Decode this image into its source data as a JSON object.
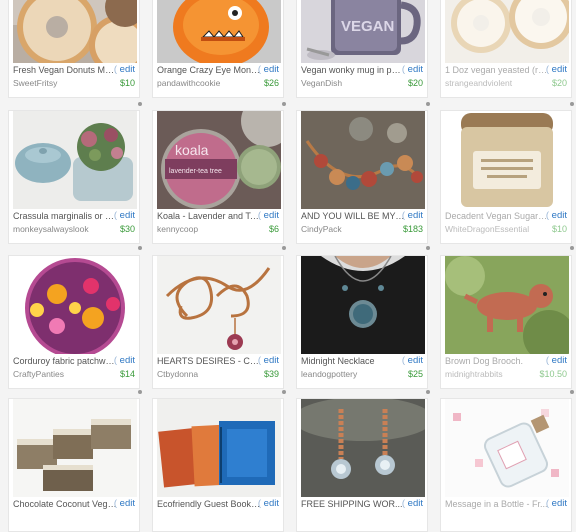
{
  "edit_label": "edit",
  "items": [
    {
      "title": "Fresh Vegan Donuts Ma...",
      "shop": "SweetFritsy",
      "price": "$10",
      "image": "donuts"
    },
    {
      "title": "Orange Crazy Eye Monst...",
      "shop": "pandawithcookie",
      "price": "$26",
      "image": "orange-monster"
    },
    {
      "title": "Vegan wonky mug in pur...",
      "shop": "VeganDish",
      "price": "$20",
      "image": "vegan-mug",
      "mug_text": "VEGAN"
    },
    {
      "title": "1 Doz vegan yeasted (rai...",
      "shop": "strangeandviolent",
      "price": "$20",
      "image": "yeasted-donuts",
      "faded": true
    },
    {
      "title": "Crassula marginalis or Ca...",
      "shop": "monkeysalwayslook",
      "price": "$30",
      "image": "succulent-pot"
    },
    {
      "title": "Koala - Lavender and Te...",
      "shop": "kennycoop",
      "price": "$6",
      "image": "koala-tins",
      "tin_text": "koala",
      "tin_sub": "lavender-tea tree"
    },
    {
      "title": "AND YOU WILL BE MY ...",
      "shop": "CindyPack",
      "price": "$183",
      "image": "bead-necklace"
    },
    {
      "title": "Decadent Vegan Sugar S...",
      "shop": "WhiteDragonEssential",
      "price": "$10",
      "image": "sugar-scrub-jar",
      "faded": true
    },
    {
      "title": "Corduroy fabric patchwo...",
      "shop": "CraftyPanties",
      "price": "$14",
      "image": "fabric-ball"
    },
    {
      "title": "HEARTS DESIRES - Co...",
      "shop": "Ctbydonna",
      "price": "$39",
      "image": "copper-pin"
    },
    {
      "title": "Midnight Necklace",
      "shop": "leandogpottery",
      "price": "$25",
      "image": "midnight-necklace"
    },
    {
      "title": "Brown Dog Brooch.",
      "shop": "midnightrabbits",
      "price": "$10.50",
      "image": "dog-brooch",
      "faded": true
    },
    {
      "title": "Chocolate Coconut Vega...",
      "shop": "",
      "price": "",
      "image": "soap-bars"
    },
    {
      "title": "Ecofriendly Guest Book ...",
      "shop": "",
      "price": "",
      "image": "guest-books"
    },
    {
      "title": "FREE SHIPPING WOR...",
      "shop": "",
      "price": "",
      "image": "chain-earrings"
    },
    {
      "title": "Message in a Bottle - Fr...",
      "shop": "",
      "price": "",
      "image": "message-bottle",
      "faded": true
    }
  ]
}
